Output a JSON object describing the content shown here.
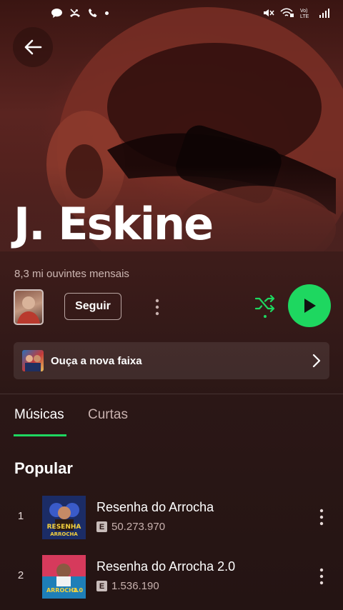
{
  "status_bar": {
    "icons_left": [
      "chat-bubble-icon",
      "missed-call-icon",
      "phone-icon",
      "notification-dot-icon"
    ],
    "icons_right": [
      "mute-icon",
      "wifi-call-icon",
      "volte-icon",
      "signal-icon"
    ],
    "volte_label": "Vo)\nLTE"
  },
  "artist": {
    "name": "J. Eskine",
    "monthly_listeners": "8,3 mi ouvintes mensais"
  },
  "actions": {
    "follow_label": "Seguir"
  },
  "new_track_banner": {
    "label": "Ouça a nova faixa"
  },
  "tabs": [
    {
      "label": "Músicas",
      "active": true
    },
    {
      "label": "Curtas",
      "active": false
    }
  ],
  "popular": {
    "title": "Popular",
    "tracks": [
      {
        "rank": "1",
        "title": "Resenha do Arrocha",
        "explicit": "E",
        "plays": "50.273.970",
        "cover_text": "RESENHA DO ARROCHA"
      },
      {
        "rank": "2",
        "title": "Resenha do Arrocha 2.0",
        "explicit": "E",
        "plays": "1.536.190",
        "cover_text": "RESENHA DO ARROCHA 2.0"
      }
    ]
  },
  "colors": {
    "accent": "#1ed760",
    "background": "#3d1c1a"
  }
}
